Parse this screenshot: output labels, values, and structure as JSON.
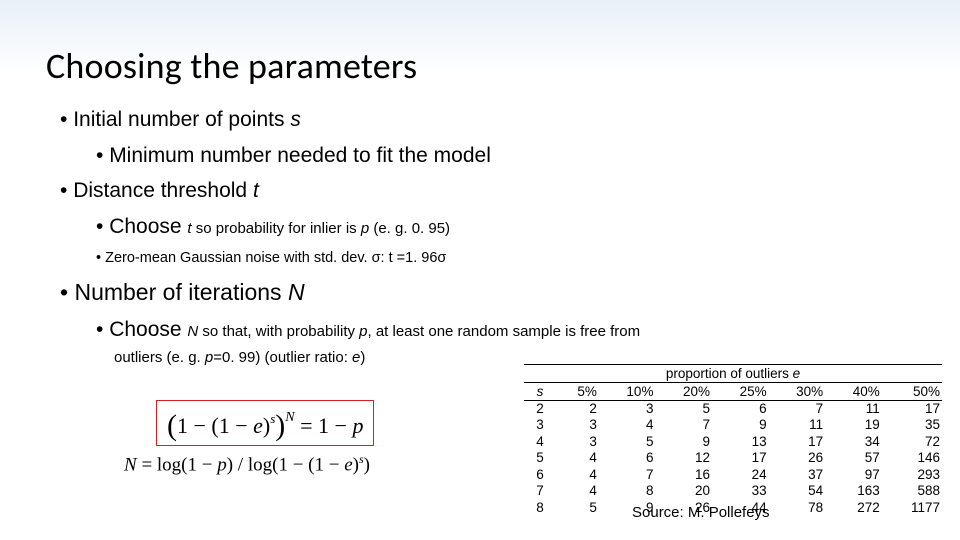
{
  "title": "Choosing the parameters",
  "bullets": {
    "b1_pre": "Initial number of points ",
    "b1_var": "s",
    "b2": "Minimum number needed to fit the model",
    "b3_pre": "Distance threshold ",
    "b3_var": "t",
    "b4_a": "Choose ",
    "b4_b_var": "t ",
    "b4_c": "so probability for inlier is ",
    "b4_d_var": "p ",
    "b4_e": "(e. g. 0. 95)",
    "b5_a": "Zero-mean Gaussian noise with std. dev. σ: t =",
    "b5_b": "1. 96σ",
    "b6_pre": "Number of iterations ",
    "b6_var": "N",
    "b7_a": "Choose ",
    "b7_b_var": "N ",
    "b7_c": "so that, with probability ",
    "b7_d_var": "p",
    "b7_e": ", at least one random sample is free from",
    "b7_f": "outliers (e. g. ",
    "b7_g_var": "p",
    "b7_h": "=0. 99) (outlier ratio: ",
    "b7_i_var": "e",
    "b7_j": ")"
  },
  "formula1": {
    "open": "(",
    "a": "1 − (1 − ",
    "e": "e",
    "close1": ")",
    "sup_s": "s",
    "close2": ")",
    "sup_N": "N",
    "rhs": " = 1 − ",
    "p": "p"
  },
  "formula2": {
    "a": "N",
    "b": " = log(1 − ",
    "p": "p",
    "c": ") / log(1 − (1 − ",
    "e": "e",
    "d": ")",
    "sup_s": "s",
    "f": ")"
  },
  "table": {
    "caption_a": "proportion of outliers ",
    "caption_e": "e",
    "headers": [
      "s",
      "5%",
      "10%",
      "20%",
      "25%",
      "30%",
      "40%",
      "50%"
    ],
    "rows": [
      [
        "2",
        "2",
        "3",
        "5",
        "6",
        "7",
        "11",
        "17"
      ],
      [
        "3",
        "3",
        "4",
        "7",
        "9",
        "11",
        "19",
        "35"
      ],
      [
        "4",
        "3",
        "5",
        "9",
        "13",
        "17",
        "34",
        "72"
      ],
      [
        "5",
        "4",
        "6",
        "12",
        "17",
        "26",
        "57",
        "146"
      ],
      [
        "6",
        "4",
        "7",
        "16",
        "24",
        "37",
        "97",
        "293"
      ],
      [
        "7",
        "4",
        "8",
        "20",
        "33",
        "54",
        "163",
        "588"
      ],
      [
        "8",
        "5",
        "9",
        "26",
        "44",
        "78",
        "272",
        "1177"
      ]
    ]
  },
  "source": "Source: M. Pollefeys"
}
